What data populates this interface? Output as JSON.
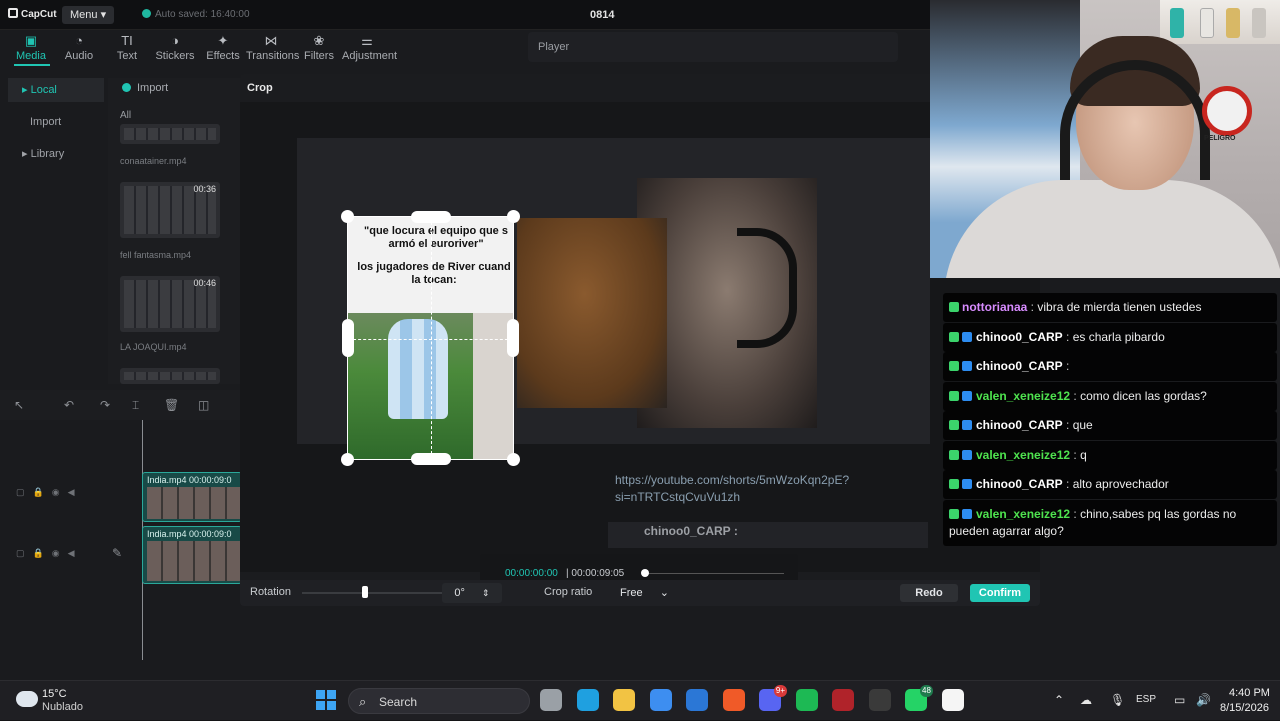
{
  "app": {
    "logo_text": "CapCut",
    "menu_label": "Menu",
    "autosave": "Auto saved: 16:40:00",
    "project_title": "0814"
  },
  "toolbar": [
    {
      "label": "Media",
      "icon": "media-icon",
      "glyph": "▣",
      "active": true
    },
    {
      "label": "Audio",
      "icon": "audio-icon",
      "glyph": "◔"
    },
    {
      "label": "Text",
      "icon": "text-icon",
      "glyph": "TI"
    },
    {
      "label": "Stickers",
      "icon": "stickers-icon",
      "glyph": "◑"
    },
    {
      "label": "Effects",
      "icon": "effects-icon",
      "glyph": "✦"
    },
    {
      "label": "Transitions",
      "icon": "transitions-icon",
      "glyph": "⋈"
    },
    {
      "label": "Filters",
      "icon": "filters-icon",
      "glyph": "❀"
    },
    {
      "label": "Adjustment",
      "icon": "adjustment-icon",
      "glyph": "⚌"
    }
  ],
  "leftnav": {
    "local": "▸ Local",
    "import": "Import",
    "library": "▸ Library"
  },
  "media": {
    "import_label": "Import",
    "all_label": "All",
    "thumbs": [
      {
        "name": "conaatainer.mp4",
        "duration": ""
      },
      {
        "name": "fell fantasma.mp4",
        "duration": "00:36"
      },
      {
        "name": "LA JOAQUI.mp4",
        "duration": "00:46"
      }
    ]
  },
  "player": {
    "label": "Player"
  },
  "timeline": {
    "tracks": [
      {
        "label": "India.mp4  00:00:09:0"
      },
      {
        "label": "India.mp4  00:00:09:0"
      }
    ]
  },
  "crop": {
    "title": "Crop",
    "overlay_text_1": "\"que locura el equipo que s armó el euroriver\"",
    "overlay_text_2": "los jugadores de River cuand la tocan:",
    "url_text": "https://youtube.com/shorts/5mWzoKqn2pE? si=nTRTCstqCvuVu1zh",
    "chat_user": "chinoo0_CARP",
    "chat_sep": ":",
    "time_current": "00:00:00:00",
    "time_total": "00:00:09:05",
    "rotation_label": "Rotation",
    "rotation_value": "0°",
    "ratio_label": "Crop ratio",
    "ratio_value": "Free",
    "redo_label": "Redo",
    "confirm_label": "Confirm",
    "accent": "#20c5b3"
  },
  "webcam": {
    "sign_text": "PELIGRO"
  },
  "chat": [
    {
      "user": "nottorianaa",
      "color": "#d88cff",
      "text": "vibra de mierda tienen ustedes",
      "badge2": false
    },
    {
      "user": "chinoo0_CARP",
      "color": "#ffffff",
      "text": "es charla pibardo",
      "badge2": true
    },
    {
      "user": "chinoo0_CARP",
      "color": "#ffffff",
      "text": "",
      "badge2": true
    },
    {
      "user": "valen_xeneize12",
      "color": "#4fe34f",
      "text": "como dicen las gordas?",
      "badge2": true
    },
    {
      "user": "chinoo0_CARP",
      "color": "#ffffff",
      "text": "que",
      "badge2": true
    },
    {
      "user": "valen_xeneize12",
      "color": "#4fe34f",
      "text": "q",
      "badge2": true
    },
    {
      "user": "chinoo0_CARP",
      "color": "#ffffff",
      "text": "alto aprovechador",
      "badge2": true
    },
    {
      "user": "valen_xeneize12",
      "color": "#4fe34f",
      "text": "chino,sabes pq las gordas no pueden agarrar algo?",
      "badge2": true
    }
  ],
  "taskbar": {
    "temp": "15°C",
    "weather": "Nublado",
    "search": "Search",
    "apps": [
      {
        "name": "task-view-icon",
        "color": "#9aa0a6",
        "badge": ""
      },
      {
        "name": "edge-icon",
        "color": "#1fa0e0",
        "badge": ""
      },
      {
        "name": "file-explorer-icon",
        "color": "#f2c343",
        "badge": ""
      },
      {
        "name": "store-icon",
        "color": "#3d8ef0",
        "badge": ""
      },
      {
        "name": "mail-icon",
        "color": "#2b77d6",
        "badge": ""
      },
      {
        "name": "brave-icon",
        "color": "#f05a28",
        "badge": ""
      },
      {
        "name": "discord-icon",
        "color": "#5865f2",
        "badge": "9+"
      },
      {
        "name": "spotify-icon",
        "color": "#1db954",
        "badge": ""
      },
      {
        "name": "voicemeeter-icon",
        "color": "#b0232a",
        "badge": ""
      },
      {
        "name": "obs-icon",
        "color": "#3a3a3a",
        "badge": ""
      },
      {
        "name": "whatsapp-icon",
        "color": "#25d366",
        "badge": "48"
      },
      {
        "name": "capcut-icon",
        "color": "#f5f5f5",
        "badge": ""
      }
    ],
    "lang": "ESP",
    "time": "4:40 PM",
    "date": "8/15/2026"
  }
}
